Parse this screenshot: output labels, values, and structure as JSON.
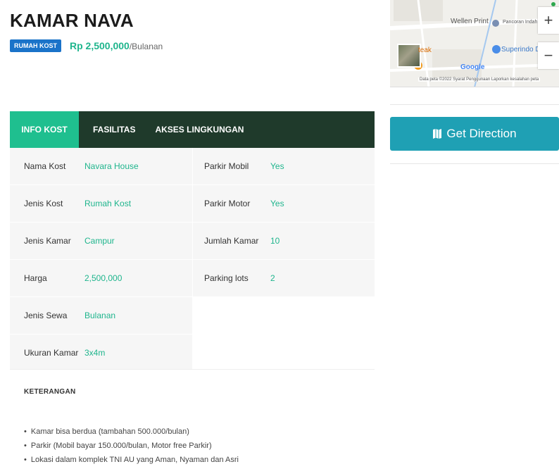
{
  "header": {
    "title": "KAMAR NAVA",
    "badge": "RUMAH KOST",
    "price": "Rp 2,500,000",
    "price_unit": "/Bulanan"
  },
  "map": {
    "labels": [
      "Wellen Print",
      "Pancoran Indah",
      "Superindo Du",
      "teak"
    ],
    "google": "Google",
    "footer": "Data peta ©2022   Syarat Penggunaan   Laporkan kesalahan peta",
    "zoom_in": "+",
    "zoom_out": "−"
  },
  "direction": {
    "label": "Get Direction",
    "color": "#1fa0b4"
  },
  "tabs": [
    {
      "label": "INFO KOST",
      "active": true
    },
    {
      "label": "FASILITAS",
      "active": false
    },
    {
      "label": "AKSES LINGKUNGAN",
      "active": false
    }
  ],
  "info_left": [
    {
      "label": "Nama Kost",
      "value": "Navara House"
    },
    {
      "label": "Jenis Kost",
      "value": "Rumah Kost"
    },
    {
      "label": "Jenis Kamar",
      "value": "Campur"
    },
    {
      "label": "Harga",
      "value": "2,500,000"
    },
    {
      "label": "Jenis Sewa",
      "value": "Bulanan"
    },
    {
      "label": "Ukuran Kamar",
      "value": "3x4m"
    }
  ],
  "info_right": [
    {
      "label": "Parkir Mobil",
      "value": "Yes"
    },
    {
      "label": "Parkir Motor",
      "value": "Yes"
    },
    {
      "label": "Jumlah Kamar",
      "value": "10"
    },
    {
      "label": "Parking lots",
      "value": "2"
    }
  ],
  "keterangan": {
    "title": "KETERANGAN",
    "items": [
      "Kamar bisa berdua (tambahan 500.000/bulan)",
      "Parkir (Mobil bayar 150.000/bulan, Motor free Parkir)",
      "Lokasi dalam komplek TNI AU yang Aman, Nyaman dan Asri"
    ]
  },
  "colors": {
    "accent": "#1fbf8f",
    "tab_bg": "#1f3a2b",
    "badge": "#1a73c9"
  }
}
